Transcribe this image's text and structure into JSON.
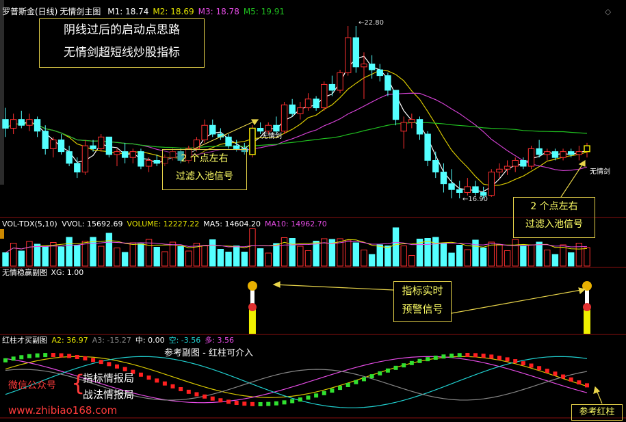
{
  "main_panel": {
    "stock_name": "罗普斯金(日线)",
    "chart_name": "无情剑主图",
    "ma": [
      {
        "label": "M1:",
        "value": "18.74",
        "color": "#ffffff"
      },
      {
        "label": "M2:",
        "value": "18.69",
        "color": "#e6e600"
      },
      {
        "label": "M3:",
        "value": "18.78",
        "color": "#e64ce6"
      },
      {
        "label": "M5:",
        "value": "19.91",
        "color": "#20c020"
      }
    ],
    "high_label": "22.80",
    "low_label": "16.90",
    "signal_tag_1": "无情剑",
    "signal_tag_2": "无情剑",
    "title_lines": [
      "阴线过后的启动点思路",
      "无情剑超短线炒股指标"
    ],
    "callout_left": [
      "2 个点左右",
      "过滤入池信号"
    ],
    "callout_right": [
      "2 个点左右",
      "过滤入池信号"
    ],
    "corner_icon": "◇"
  },
  "volume_panel": {
    "name": "VOL-TDX(5,10)",
    "items": [
      {
        "label": "VVOL:",
        "value": "15692.69",
        "color": "#ffffff"
      },
      {
        "label": "VOLUME:",
        "value": "12227.22",
        "color": "#e6e600"
      },
      {
        "label": "MA5:",
        "value": "14604.20",
        "color": "#ffffff"
      },
      {
        "label": "MA10:",
        "value": "14962.70",
        "color": "#e64ce6"
      }
    ]
  },
  "signal_panel": {
    "name": "无情稳赢副图",
    "xg": "XG: 1.00",
    "callout": [
      "指标实时",
      "预警信号"
    ]
  },
  "sub_panel": {
    "name": "红柱才买副图",
    "items": [
      {
        "label": "A2:",
        "value": "36.97",
        "color": "#e6e600"
      },
      {
        "label": "A3:",
        "value": "-15.27",
        "color": "#888888"
      },
      {
        "label": "中:",
        "value": "0.00",
        "color": "#ffffff"
      },
      {
        "label": "空:",
        "value": "-3.56",
        "color": "#20d0d0"
      },
      {
        "label": "多:",
        "value": "3.56",
        "color": "#e64ce6"
      }
    ],
    "subtitle": "参考副图 - 红柱可介入",
    "ref_callout": "参考红柱"
  },
  "watermark": {
    "wechat": "微信公众号",
    "brand1": "指标情报局",
    "brand2": "战法情报局",
    "url": "www.zhibiao168.com"
  },
  "chart_data": {
    "type": "candlestick",
    "candles": [
      {
        "o": 19.6,
        "h": 20.0,
        "l": 19.0,
        "c": 19.3
      },
      {
        "o": 19.3,
        "h": 19.8,
        "l": 19.1,
        "c": 19.6
      },
      {
        "o": 19.6,
        "h": 19.9,
        "l": 19.3,
        "c": 19.4
      },
      {
        "o": 19.4,
        "h": 19.8,
        "l": 19.2,
        "c": 19.6
      },
      {
        "o": 19.6,
        "h": 19.7,
        "l": 19.0,
        "c": 19.2
      },
      {
        "o": 19.2,
        "h": 19.4,
        "l": 18.4,
        "c": 18.6
      },
      {
        "o": 18.6,
        "h": 19.0,
        "l": 18.3,
        "c": 18.9
      },
      {
        "o": 18.9,
        "h": 19.1,
        "l": 18.4,
        "c": 18.5
      },
      {
        "o": 18.5,
        "h": 18.7,
        "l": 18.0,
        "c": 18.1
      },
      {
        "o": 18.1,
        "h": 18.3,
        "l": 17.6,
        "c": 17.8
      },
      {
        "o": 17.8,
        "h": 18.9,
        "l": 17.7,
        "c": 18.7
      },
      {
        "o": 18.7,
        "h": 18.9,
        "l": 18.5,
        "c": 18.6
      },
      {
        "o": 18.6,
        "h": 19.1,
        "l": 18.5,
        "c": 19.0
      },
      {
        "o": 19.0,
        "h": 19.0,
        "l": 18.3,
        "c": 18.4
      },
      {
        "o": 18.4,
        "h": 18.6,
        "l": 18.0,
        "c": 18.5
      },
      {
        "o": 18.5,
        "h": 18.8,
        "l": 18.1,
        "c": 18.3
      },
      {
        "o": 18.3,
        "h": 18.6,
        "l": 18.1,
        "c": 18.5
      },
      {
        "o": 18.5,
        "h": 18.6,
        "l": 17.9,
        "c": 18.0
      },
      {
        "o": 18.0,
        "h": 18.3,
        "l": 17.8,
        "c": 18.2
      },
      {
        "o": 18.2,
        "h": 18.4,
        "l": 18.0,
        "c": 18.1
      },
      {
        "o": 18.1,
        "h": 18.4,
        "l": 18.0,
        "c": 18.3
      },
      {
        "o": 18.3,
        "h": 18.6,
        "l": 18.2,
        "c": 18.5
      },
      {
        "o": 18.5,
        "h": 18.6,
        "l": 18.1,
        "c": 18.2
      },
      {
        "o": 18.2,
        "h": 18.7,
        "l": 18.1,
        "c": 18.6
      },
      {
        "o": 18.6,
        "h": 19.0,
        "l": 18.5,
        "c": 18.9
      },
      {
        "o": 18.9,
        "h": 19.6,
        "l": 18.8,
        "c": 19.4
      },
      {
        "o": 19.4,
        "h": 19.6,
        "l": 19.0,
        "c": 19.1
      },
      {
        "o": 19.1,
        "h": 19.3,
        "l": 18.9,
        "c": 19.0
      },
      {
        "o": 19.0,
        "h": 19.1,
        "l": 18.6,
        "c": 18.7
      },
      {
        "o": 18.7,
        "h": 18.9,
        "l": 18.5,
        "c": 18.6
      },
      {
        "o": 18.6,
        "h": 18.8,
        "l": 18.4,
        "c": 18.5
      },
      {
        "o": 18.4,
        "h": 19.4,
        "l": 18.3,
        "c": 19.3
      },
      {
        "o": 19.3,
        "h": 19.5,
        "l": 19.1,
        "c": 19.2
      },
      {
        "o": 19.2,
        "h": 19.5,
        "l": 19.1,
        "c": 19.4
      },
      {
        "o": 19.4,
        "h": 19.7,
        "l": 19.1,
        "c": 19.2
      },
      {
        "o": 19.2,
        "h": 20.2,
        "l": 19.1,
        "c": 20.1
      },
      {
        "o": 20.1,
        "h": 20.3,
        "l": 19.7,
        "c": 19.8
      },
      {
        "o": 19.8,
        "h": 20.2,
        "l": 19.6,
        "c": 20.0
      },
      {
        "o": 20.0,
        "h": 20.5,
        "l": 19.9,
        "c": 20.3
      },
      {
        "o": 20.3,
        "h": 20.4,
        "l": 19.9,
        "c": 20.0
      },
      {
        "o": 20.0,
        "h": 20.9,
        "l": 19.9,
        "c": 20.8
      },
      {
        "o": 20.8,
        "h": 21.1,
        "l": 20.4,
        "c": 20.6
      },
      {
        "o": 20.6,
        "h": 21.3,
        "l": 20.5,
        "c": 21.2
      },
      {
        "o": 21.2,
        "h": 22.8,
        "l": 21.1,
        "c": 22.4
      },
      {
        "o": 22.4,
        "h": 22.8,
        "l": 21.2,
        "c": 21.4
      },
      {
        "o": 21.4,
        "h": 21.9,
        "l": 20.3,
        "c": 21.5
      },
      {
        "o": 21.5,
        "h": 21.8,
        "l": 21.0,
        "c": 21.3
      },
      {
        "o": 21.3,
        "h": 21.5,
        "l": 20.9,
        "c": 21.1
      },
      {
        "o": 21.1,
        "h": 21.2,
        "l": 20.4,
        "c": 20.6
      },
      {
        "o": 20.6,
        "h": 20.6,
        "l": 19.4,
        "c": 19.6
      },
      {
        "o": 19.2,
        "h": 19.7,
        "l": 18.6,
        "c": 19.5
      },
      {
        "o": 19.5,
        "h": 19.8,
        "l": 19.3,
        "c": 19.6
      },
      {
        "o": 19.6,
        "h": 19.7,
        "l": 18.9,
        "c": 19.1
      },
      {
        "o": 19.1,
        "h": 19.2,
        "l": 18.0,
        "c": 18.2
      },
      {
        "o": 18.2,
        "h": 18.5,
        "l": 17.6,
        "c": 17.8
      },
      {
        "o": 17.8,
        "h": 18.1,
        "l": 17.1,
        "c": 17.4
      },
      {
        "o": 17.4,
        "h": 17.9,
        "l": 16.9,
        "c": 17.2
      },
      {
        "o": 17.2,
        "h": 17.5,
        "l": 16.9,
        "c": 17.1
      },
      {
        "o": 17.1,
        "h": 17.6,
        "l": 17.0,
        "c": 17.3
      },
      {
        "o": 17.3,
        "h": 17.5,
        "l": 17.0,
        "c": 17.1
      },
      {
        "o": 17.1,
        "h": 17.3,
        "l": 16.9,
        "c": 17.0
      },
      {
        "o": 17.0,
        "h": 17.9,
        "l": 16.95,
        "c": 17.8
      },
      {
        "o": 17.8,
        "h": 18.1,
        "l": 17.6,
        "c": 17.9
      },
      {
        "o": 17.9,
        "h": 18.2,
        "l": 17.7,
        "c": 18.0
      },
      {
        "o": 18.0,
        "h": 18.3,
        "l": 17.8,
        "c": 18.2
      },
      {
        "o": 18.2,
        "h": 18.3,
        "l": 17.9,
        "c": 18.0
      },
      {
        "o": 18.0,
        "h": 18.7,
        "l": 17.9,
        "c": 18.6
      },
      {
        "o": 18.6,
        "h": 18.9,
        "l": 18.3,
        "c": 18.4
      },
      {
        "o": 18.4,
        "h": 18.6,
        "l": 18.2,
        "c": 18.5
      },
      {
        "o": 18.5,
        "h": 18.6,
        "l": 18.2,
        "c": 18.3
      },
      {
        "o": 18.3,
        "h": 18.6,
        "l": 18.2,
        "c": 18.5
      },
      {
        "o": 18.5,
        "h": 18.6,
        "l": 18.3,
        "c": 18.4
      },
      {
        "o": 18.4,
        "h": 18.7,
        "l": 18.2,
        "c": 18.5
      },
      {
        "o": 18.5,
        "h": 18.8,
        "l": 18.3,
        "c": 18.7
      }
    ],
    "high": 22.8,
    "low": 16.9
  }
}
